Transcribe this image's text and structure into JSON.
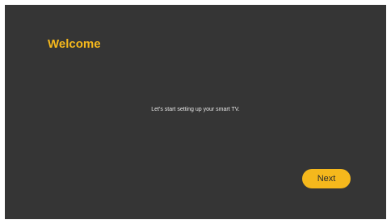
{
  "welcome": {
    "title": "Welcome",
    "message": "Let's start setting up your smart TV.",
    "next_label": "Next"
  },
  "colors": {
    "background": "#353535",
    "accent": "#f5b81c",
    "text": "#e6e6e6"
  }
}
